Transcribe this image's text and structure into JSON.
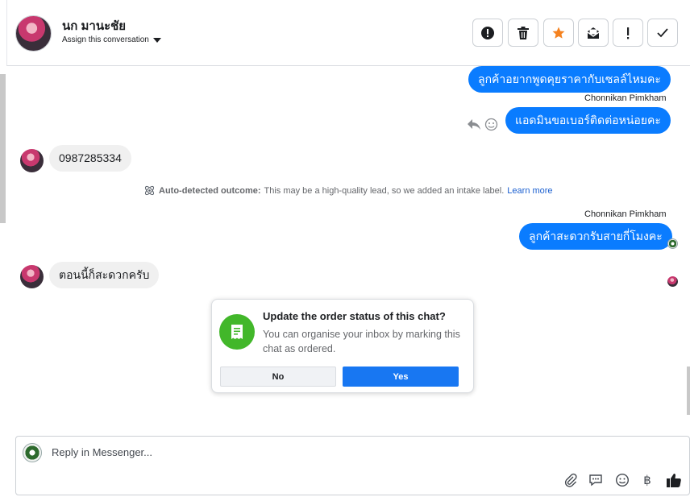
{
  "header": {
    "contact_name": "นก มานะชัย",
    "assign_label": "Assign this conversation",
    "actions": [
      {
        "name": "mark-spam-button",
        "icon": "alert-circle-icon"
      },
      {
        "name": "delete-button",
        "icon": "trash-icon"
      },
      {
        "name": "star-button",
        "icon": "star-icon"
      },
      {
        "name": "mark-unread-button",
        "icon": "envelope-icon"
      },
      {
        "name": "follow-up-button",
        "icon": "exclamation-icon"
      },
      {
        "name": "mark-done-button",
        "icon": "checkmark-icon"
      }
    ]
  },
  "messages": {
    "out1": "ลูกค้าอยากพูดคุยราคากับเซลล์ไหมคะ",
    "sender1": "Chonnikan Pimkham",
    "out2": "แอดมินขอเบอร์ติดต่อหน่อยคะ",
    "in1": "0987285334",
    "sender2": "Chonnikan Pimkham",
    "out3": "ลูกค้าสะดวกรับสายกี่โมงคะ",
    "in2": "ตอนนี้ก็สะดวกครับ"
  },
  "outcome": {
    "label": "Auto-detected outcome:",
    "text": "This may be a high-quality lead, so we added an intake label.",
    "link": "Learn more"
  },
  "order_card": {
    "title": "Update the order status of this chat?",
    "body": "You can organise your inbox by marking this chat as ordered.",
    "no_label": "No",
    "yes_label": "Yes"
  },
  "composer": {
    "placeholder": "Reply in Messenger...",
    "currency_symbol": "฿"
  },
  "colors": {
    "outgoing_bubble": "#0a7cff",
    "incoming_bubble": "#f0f0f0",
    "yes_button": "#1877f2",
    "order_icon": "#42b72a",
    "star": "#f5821f"
  }
}
